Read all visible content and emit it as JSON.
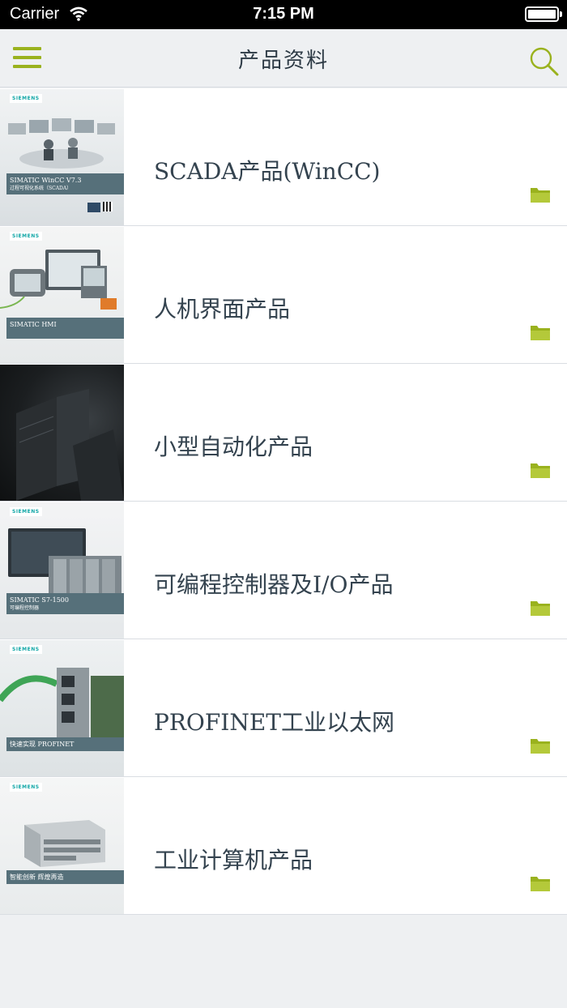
{
  "status_bar": {
    "carrier": "Carrier",
    "time": "7:15 PM"
  },
  "nav": {
    "title": "产品资料",
    "menu_icon": "hamburger-icon",
    "search_icon": "search-icon"
  },
  "colors": {
    "accent": "#9ab21e",
    "text": "#34434f",
    "background": "#eef0f2"
  },
  "items": [
    {
      "label": "SCADA产品(WinCC)",
      "thumb_logo": "SIEMENS",
      "thumb_title": "SIMATIC WinCC V7.3",
      "thumb_sub": "过程可视化系统（SCADA）"
    },
    {
      "label": "人机界面产品",
      "thumb_logo": "SIEMENS",
      "thumb_title": "SIMATIC HMI",
      "thumb_sub": ""
    },
    {
      "label": "小型自动化产品",
      "thumb_logo": "",
      "thumb_title": "",
      "thumb_sub": ""
    },
    {
      "label": "可编程控制器及I/O产品",
      "thumb_logo": "SIEMENS",
      "thumb_title": "SIMATIC S7-1500",
      "thumb_sub": "可编程控制器"
    },
    {
      "label": "PROFINET工业以太网",
      "thumb_logo": "SIEMENS",
      "thumb_title": "快速实现 PROFINET",
      "thumb_sub": ""
    },
    {
      "label": "工业计算机产品",
      "thumb_logo": "SIEMENS",
      "thumb_title": "智能创新 辉煌再造",
      "thumb_sub": ""
    }
  ]
}
